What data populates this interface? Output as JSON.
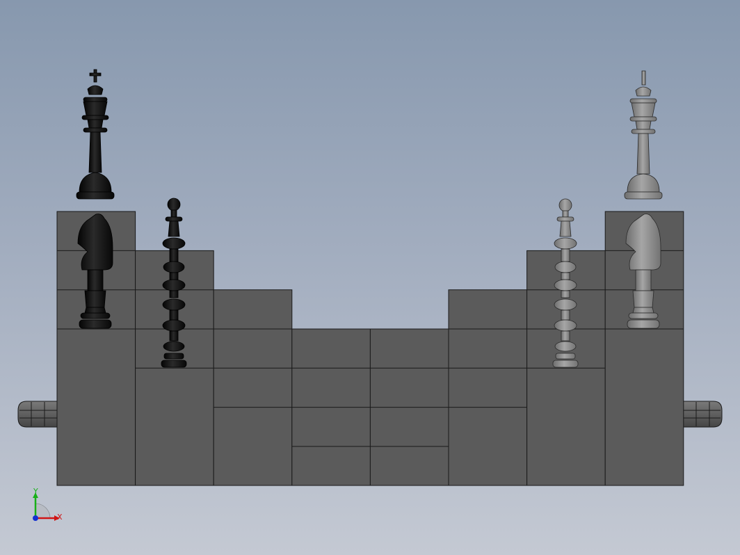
{
  "viewport": {
    "background_top": "#8798ae",
    "background_bottom": "#c4c9d3"
  },
  "model": {
    "block_color": "#5b5b5b",
    "edge_color": "#1a1a1a",
    "black_piece_color": "#151515",
    "white_piece_color": "#8c8c8c",
    "column_heights": [
      4,
      3,
      2,
      1,
      1,
      2,
      3,
      4
    ],
    "black_pieces": [
      "king",
      "knight",
      "pawn"
    ],
    "white_pieces": [
      "king",
      "knight",
      "pawn"
    ],
    "end_knobs": [
      "left",
      "right"
    ]
  },
  "triad": {
    "x_label": "X",
    "y_label": "Y",
    "x_color": "#d01515",
    "y_color": "#18b018",
    "z_color": "#1530d0",
    "icon": "coordinate-triad-icon"
  }
}
